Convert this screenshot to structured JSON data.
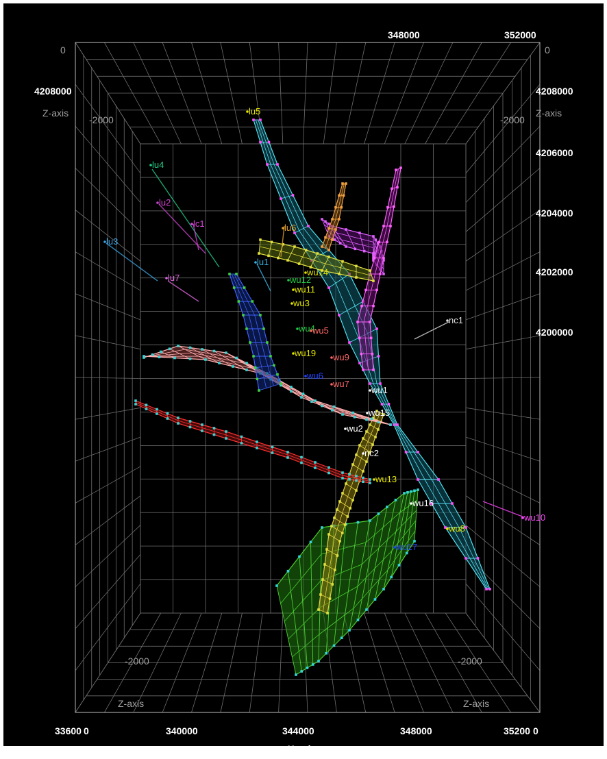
{
  "chart_data": {
    "type": "3d-wireframe-surface-plot",
    "background_color": "#000000",
    "grid_color": "#6e6e6e",
    "grid": true,
    "x_axis": {
      "label": "X-axis",
      "range": [
        336000,
        352000
      ],
      "ticks": [
        "336000",
        "340000",
        "344000",
        "348000",
        "352000"
      ]
    },
    "y_axis": {
      "ticks": [
        "4200000",
        "4202000",
        "4204000",
        "4206000",
        "4208000"
      ]
    },
    "z_axis": {
      "label": "Z-axis",
      "range": [
        -2500,
        0
      ],
      "ticks_top": [
        "0",
        "-2000"
      ],
      "ticks_bottom": [
        "-2000"
      ]
    },
    "top_x_ticks": [
      "348000",
      "352000"
    ],
    "corner_labels": {
      "bottom_left_overlap": "33600",
      "bottom_left_suffix": "0",
      "bottom_right_overlap": "35200",
      "bottom_right_suffix": "0"
    },
    "well_labels": [
      {
        "name": "lu5",
        "color": "#e6e600"
      },
      {
        "name": "lu4",
        "color": "#22cc88"
      },
      {
        "name": "lu2",
        "color": "#cc44cc"
      },
      {
        "name": "lc1",
        "color": "#dd44dd"
      },
      {
        "name": "lu3",
        "color": "#3aa0e0"
      },
      {
        "name": "lu7",
        "color": "#dd66dd"
      },
      {
        "name": "lu6",
        "color": "#e0a030"
      },
      {
        "name": "lu1",
        "color": "#3ab0e0"
      },
      {
        "name": "wu14",
        "color": "#e6e600"
      },
      {
        "name": "wu12",
        "color": "#22cc44"
      },
      {
        "name": "wu11",
        "color": "#e6e600"
      },
      {
        "name": "wu3",
        "color": "#e6e600"
      },
      {
        "name": "wu4",
        "color": "#22cc44"
      },
      {
        "name": "wu5",
        "color": "#ff6666"
      },
      {
        "name": "wu19",
        "color": "#e6e600"
      },
      {
        "name": "wu9",
        "color": "#ff6666"
      },
      {
        "name": "wu6",
        "color": "#2244ff"
      },
      {
        "name": "wu7",
        "color": "#ff6666"
      },
      {
        "name": "wu1",
        "color": "#ffffff"
      },
      {
        "name": "wu15",
        "color": "#ffffff"
      },
      {
        "name": "wu2",
        "color": "#ffffff"
      },
      {
        "name": "nc2",
        "color": "#ffffff"
      },
      {
        "name": "nc1",
        "color": "#e0e0e0"
      },
      {
        "name": "wu13",
        "color": "#e6e600"
      },
      {
        "name": "wu16",
        "color": "#ffffff"
      },
      {
        "name": "wu8",
        "color": "#e6e600"
      },
      {
        "name": "wu10",
        "color": "#ff44ff"
      },
      {
        "name": "wu17",
        "color": "#2244ff"
      }
    ]
  }
}
